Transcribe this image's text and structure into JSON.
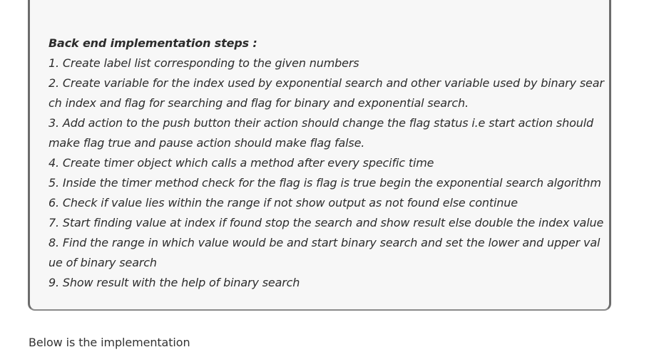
{
  "callout": {
    "heading": "Back end implementation steps :",
    "steps": [
      "1. Create label list corresponding to the given numbers",
      "2. Create variable for the index used by exponential search and other variable used by binary search index and flag for searching and flag for binary and exponential search.",
      "3. Add action to the push button their action should change the flag status i.e start action should make flag true and pause action should make flag false.",
      "4. Create timer object which calls a method after every specific time",
      "5. Inside the timer method check for the flag is flag is true begin the exponential search algorithm",
      "6. Check if value lies within the range if not show output as not found else continue",
      "7. Start finding value at index if found stop the search and show result else double the index value",
      "8. Find the range in which value would be and start binary search and set the lower and upper value of binary search",
      "9. Show result with the help of binary search"
    ]
  },
  "below_text": "Below is the implementation"
}
